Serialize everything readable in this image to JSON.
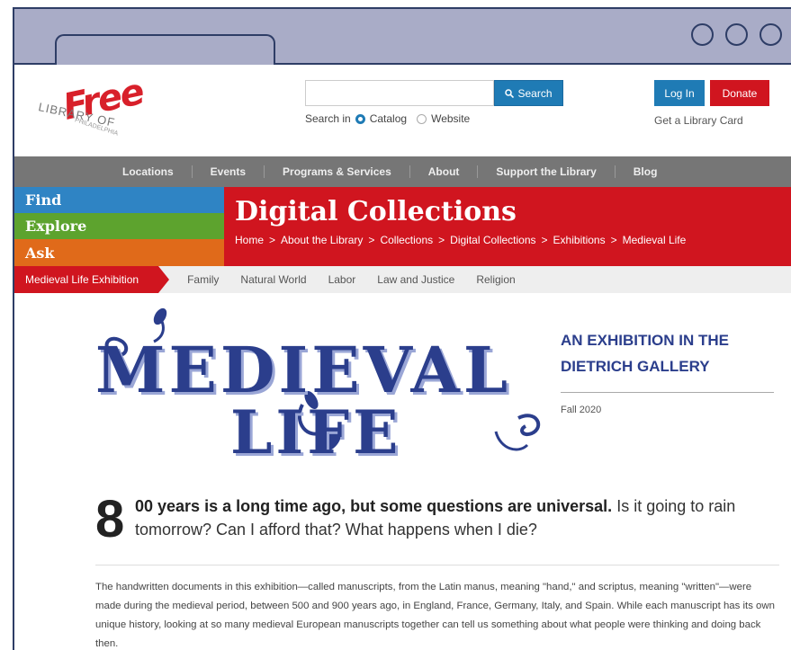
{
  "logo": {
    "free": "Free",
    "library": "LIBRARY OF",
    "city": "PHILADELPHIA"
  },
  "search": {
    "button_label": "Search",
    "search_in_label": "Search in",
    "option_catalog": "Catalog",
    "option_website": "Website",
    "placeholder": ""
  },
  "account": {
    "login_label": "Log In",
    "donate_label": "Donate",
    "card_link": "Get a Library Card"
  },
  "nav": {
    "items": [
      "Locations",
      "Events",
      "Programs & Services",
      "About",
      "Support the Library",
      "Blog"
    ]
  },
  "side_menu": {
    "find": "Find",
    "explore": "Explore",
    "ask": "Ask"
  },
  "banner": {
    "title": "Digital Collections",
    "breadcrumbs": [
      "Home",
      ">",
      "About the Library",
      ">",
      "Collections",
      ">",
      "Digital Collections",
      ">",
      "Exhibitions",
      ">",
      "Medieval Life"
    ]
  },
  "subnav": {
    "active": "Medieval Life Exhibition",
    "tabs": [
      "Family",
      "Natural World",
      "Labor",
      "Law and Justice",
      "Religion"
    ]
  },
  "hero": {
    "title_line1": "MEDIEVAL",
    "title_line2": "LIFE",
    "subtitle": "AN EXHIBITION IN THE DIETRICH GALLERY",
    "date": "Fall 2020"
  },
  "intro": {
    "drop_cap": "8",
    "bold_text": "00 years is a long time ago, but some questions are universal.",
    "rest_text": " Is it going to rain tomorrow? Can I afford that? What happens when I die?"
  },
  "body": {
    "paragraph": "The handwritten documents in this exhibition—called manuscripts, from the Latin manus, meaning \"hand,\" and scriptus, meaning \"written\"—were made during the medieval period, between 500 and 900 years ago, in England, France, Germany, Italy, and Spain. While each manuscript has its own unique history, looking at so many medieval European manuscripts together can tell us something about what people were thinking and doing back then."
  },
  "colors": {
    "red": "#d0151f",
    "blue": "#1f7bb5",
    "navy": "#2b3e8c",
    "green": "#5da32e",
    "orange": "#e06a1a"
  }
}
